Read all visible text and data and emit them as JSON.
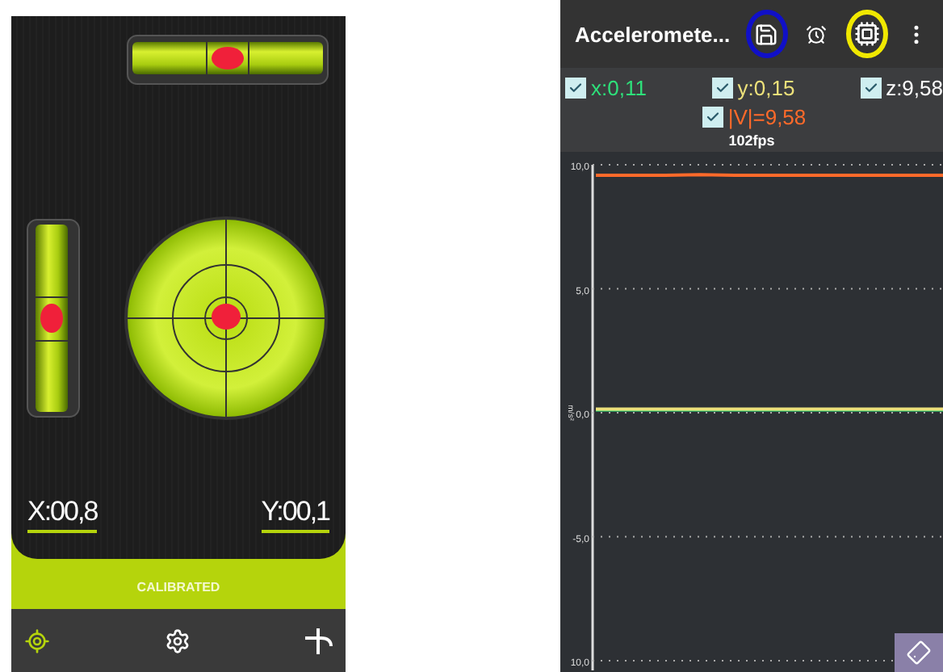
{
  "level_app": {
    "readings": [
      {
        "label": "X:00,8"
      },
      {
        "label": "Y:00,1"
      }
    ],
    "status": "CALIBRATED",
    "bottom_bar": [
      {
        "kind": "crosshair"
      },
      {
        "kind": "settings"
      },
      {
        "kind": "pin"
      }
    ]
  },
  "sensor_app": {
    "title": "Acceleromete...",
    "toolbar": [
      {
        "kind": "save",
        "color": "#1010c8"
      },
      {
        "kind": "alarm"
      },
      {
        "kind": "chip",
        "color": "#f0e800"
      },
      {
        "kind": "more"
      }
    ],
    "channels": [
      {
        "label": "x:0,11",
        "checked": true,
        "color": "#2ee07a"
      },
      {
        "label": "y:0,15",
        "checked": true,
        "color": "#ece07a"
      },
      {
        "label": "z:9,58",
        "checked": true,
        "color": "#ffffff"
      },
      {
        "label": "|V|=9,58",
        "checked": true,
        "color": "#ff6a2a"
      }
    ],
    "fps": "102fps",
    "chart_data": {
      "type": "line",
      "ylabel": "m/s²",
      "grid": true,
      "ylim": [
        -10,
        10
      ],
      "yticks": [
        {
          "value": 10,
          "label": "10,0"
        },
        {
          "value": 5,
          "label": "5,0"
        },
        {
          "value": 0,
          "label": "0,0"
        },
        {
          "value": -5,
          "label": "-5,0"
        },
        {
          "value": -10,
          "label": "10,0"
        }
      ],
      "series": [
        {
          "color": "#2ee07a",
          "values": [
            0.11,
            0.11,
            0.11,
            0.11,
            0.11,
            0.11,
            0.11,
            0.11,
            0.11,
            0.11,
            0.11
          ]
        },
        {
          "color": "#ece07a",
          "values": [
            0.15,
            0.15,
            0.15,
            0.15,
            0.15,
            0.15,
            0.15,
            0.15,
            0.15,
            0.15,
            0.15
          ]
        },
        {
          "color": "#ff6a2a",
          "values": [
            9.58,
            9.58,
            9.58,
            9.6,
            9.58,
            9.58,
            9.58,
            9.58,
            9.58,
            9.58,
            9.58
          ]
        }
      ]
    }
  }
}
